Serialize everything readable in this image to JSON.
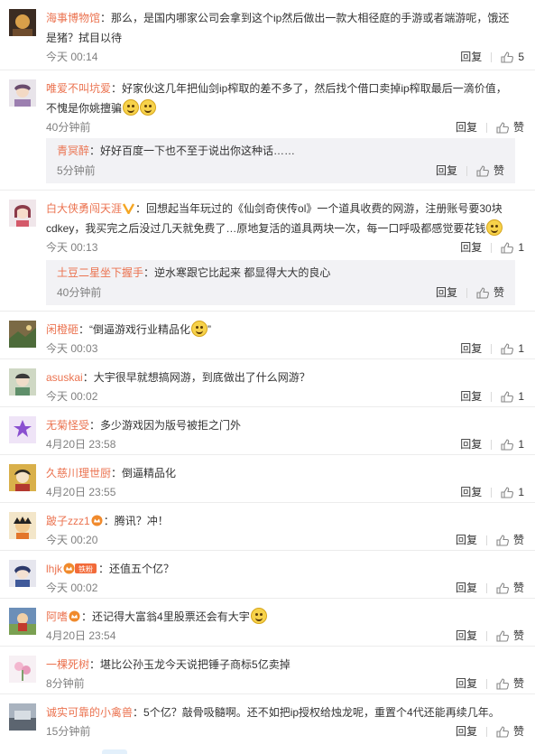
{
  "ui": {
    "reply_label": "回复",
    "like_label": "赞"
  },
  "comments": [
    {
      "user": "海事博物馆",
      "text": "：那么，是国内哪家公司会拿到这个ip然后做出一款大相径庭的手游或者端游呢，饿还",
      "text2": "是猪？拭目以待",
      "time": "今天 00:14",
      "likes": "5"
    },
    {
      "user": "唯爱不叫坑爱",
      "text": "：好家伙这几年把仙剑ip榨取的差不多了，然后找个借口卖掉ip榨取最后一滴价值，",
      "text2": "不愧是你姚擅骗",
      "time": "40分钟前",
      "likes": "赞",
      "reply": {
        "user": "青冥醉",
        "text": "：好好百度一下也不至于说出你这种话……",
        "time": "5分钟前",
        "likes": "赞"
      }
    },
    {
      "user": "白大侠勇闯天涯",
      "text": "：回想起当年玩过的《仙剑奇侠传ol》一个道具收费的网游，注册账号要30块",
      "text2": "cdkey，我买完之后没过几天就免费了…原地复活的道具两块一次，每一口呼吸都感觉要花钱",
      "time": "今天 00:13",
      "likes": "1",
      "reply": {
        "user": "土豆二星坐下握手",
        "text": "：逆水寒跟它比起来 都显得大大的良心",
        "time": "40分钟前",
        "likes": "赞"
      }
    },
    {
      "user": "闲橙砸",
      "text": "：“倒逼游戏行业精品化",
      "text_after": "”",
      "time": "今天 00:03",
      "likes": "1"
    },
    {
      "user": "asuskai",
      "text": "：大宇很早就想搞网游，到底做出了什么网游？",
      "time": "今天 00:02",
      "likes": "1"
    },
    {
      "user": "无菊怪受",
      "text": "：多少游戏因为版号被拒之门外",
      "time": "4月20日 23:58",
      "likes": "1"
    },
    {
      "user": "久慈川理世厨",
      "text": "：倒逼精品化",
      "time": "4月20日 23:55",
      "likes": "1"
    },
    {
      "user": "跛子zzz1",
      "text": "：腾讯？冲！",
      "time": "今天 00:20",
      "likes": "赞"
    },
    {
      "user": "lhjk",
      "badge": "铁粉",
      "text": "：还值五个亿？",
      "time": "今天 00:02",
      "likes": "赞"
    },
    {
      "user": "阿嗜",
      "text": "：还记得大富翁4里股票还会有大宇",
      "time": "4月20日 23:54",
      "likes": "赞"
    },
    {
      "user": "一棵死树",
      "text": "：堪比公孙玉龙今天说把锤子商标5亿卖掉",
      "time": "8分钟前",
      "likes": "赞"
    },
    {
      "user": "诚实可靠的小禽兽",
      "text": "：5个亿？敲骨吸髓啊。还不如把ip授权给烛龙呢，重置个4代还能再续几年。",
      "time": "15分钟前",
      "likes": "赞"
    }
  ],
  "colors": {
    "username": "#eb7350",
    "meta": "#808080",
    "reply_bg": "#f2f2f5"
  }
}
